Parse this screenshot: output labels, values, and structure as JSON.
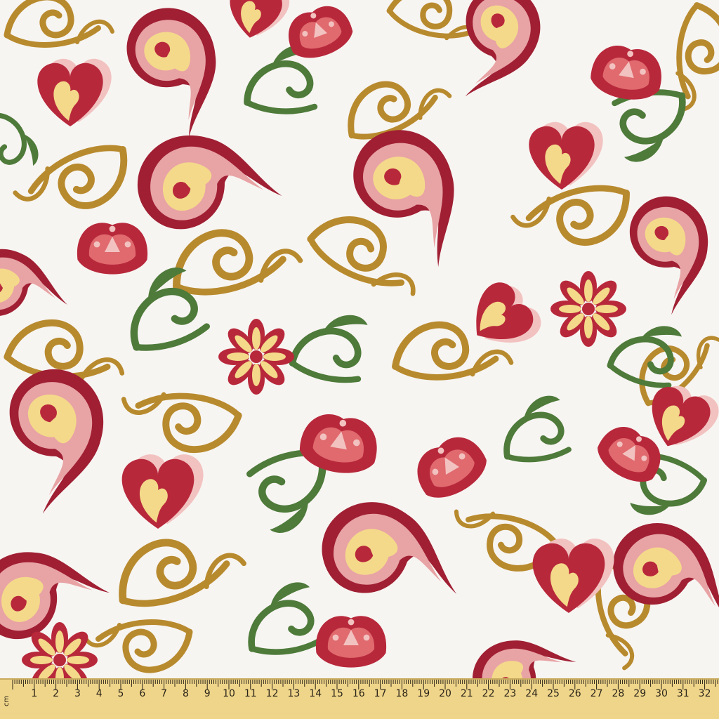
{
  "image": {
    "subject": "paisley pattern fabric with measuring tape",
    "motifs": [
      "paisley",
      "heart",
      "tulip",
      "daisy",
      "swirl"
    ],
    "palette": {
      "background": "#f7f5f2",
      "red": "#b8283b",
      "dark_red": "#a01f33",
      "pink": "#e8a3a5",
      "light_pink": "#f2c2c0",
      "coral": "#e06a6e",
      "cream": "#f4d98a",
      "gold": "#b88a2e",
      "green": "#4e7a3a",
      "ruler": "#efd58a",
      "ruler_text": "#2b2418"
    }
  },
  "ruler": {
    "unit_label": "cm",
    "numbers": [
      "1",
      "2",
      "3",
      "4",
      "5",
      "6",
      "7",
      "8",
      "9",
      "10",
      "11",
      "12",
      "13",
      "14",
      "15",
      "16",
      "17",
      "18",
      "19",
      "20",
      "21",
      "22",
      "23",
      "24",
      "25",
      "26",
      "27",
      "28",
      "29",
      "30",
      "31",
      "32",
      "3"
    ]
  }
}
